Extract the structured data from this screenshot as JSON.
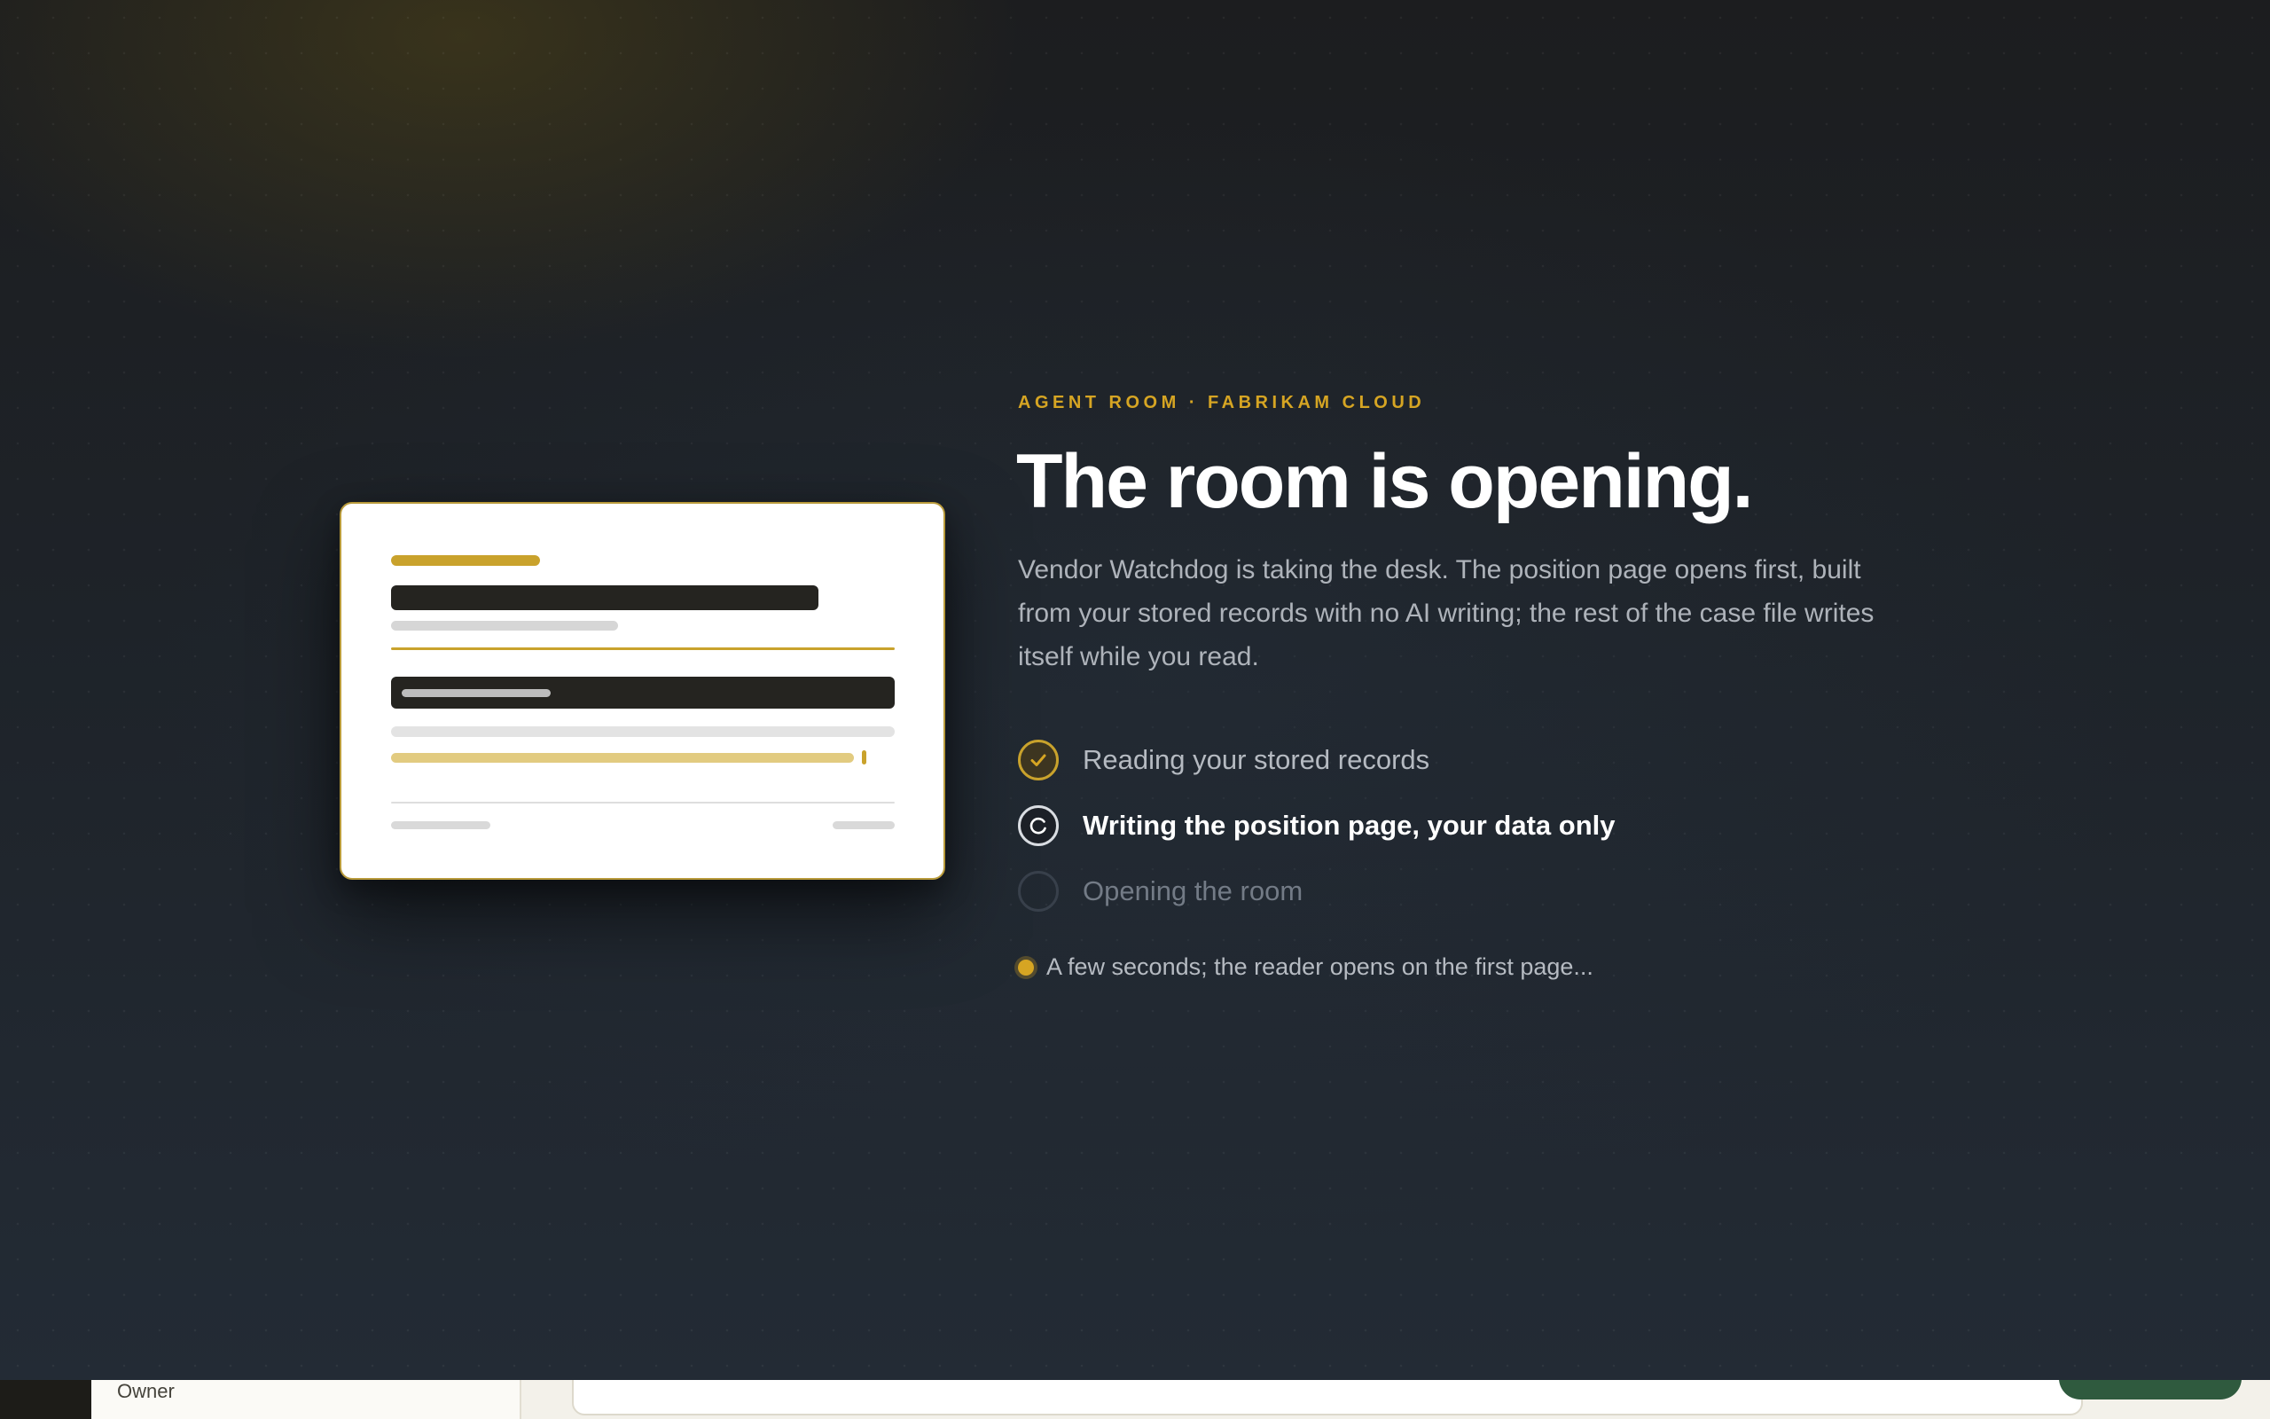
{
  "overlay": {
    "eyebrow": "AGENT ROOM · FABRIKAM CLOUD",
    "headline": "The room is opening.",
    "lede": "Vendor Watchdog is taking the desk. The position page opens first, built from your stored records with no AI writing; the rest of the case file writes itself while you read.",
    "steps": [
      {
        "label": "Reading your stored records",
        "status": "done",
        "icon": "check-icon"
      },
      {
        "label": "Writing the position page, your data only",
        "status": "active",
        "icon": "spinner-icon"
      },
      {
        "label": "Opening the room",
        "status": "pending",
        "icon": "empty-circle-icon"
      }
    ],
    "note": "A few seconds; the reader opens on the first page..."
  },
  "underlay": {
    "sidebar_label": "Owner"
  },
  "colors": {
    "accent": "#d6a523",
    "brand_green": "#2f5a3e"
  }
}
